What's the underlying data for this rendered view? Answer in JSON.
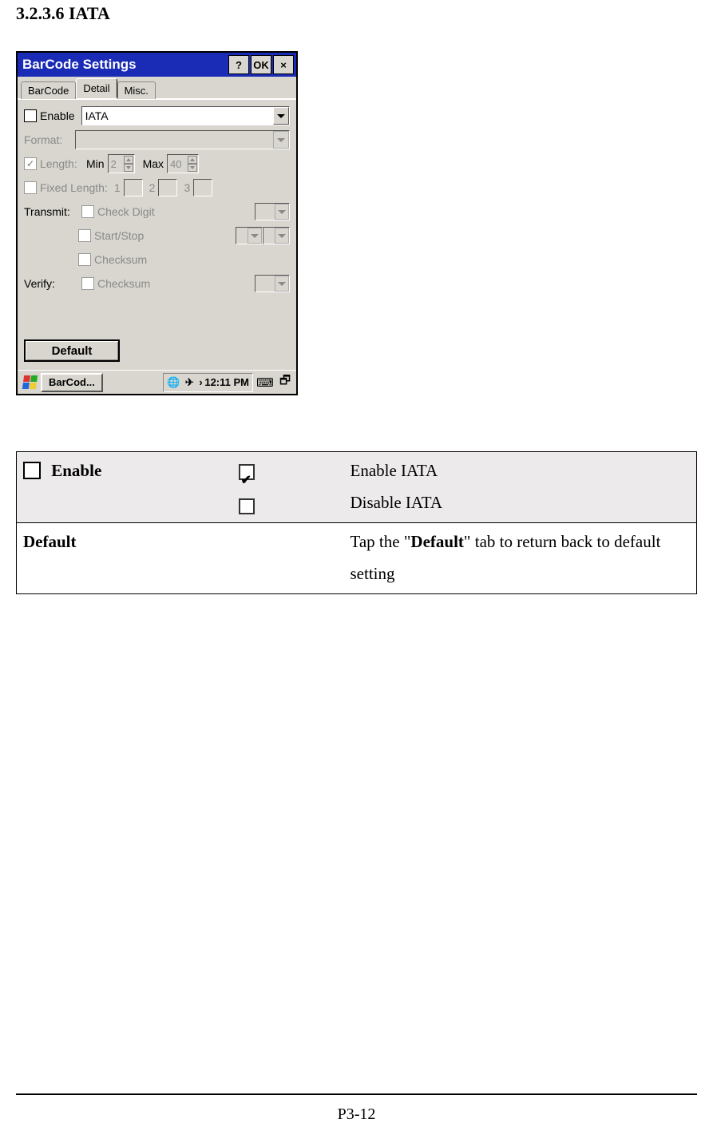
{
  "heading": "3.2.3.6 IATA",
  "dialog": {
    "title": "BarCode Settings",
    "buttons": {
      "help": "?",
      "ok": "OK",
      "close": "×"
    },
    "tabs": [
      "BarCode",
      "Detail",
      "Misc."
    ],
    "active_tab": "Detail",
    "fields": {
      "enable_label": "Enable",
      "symbology": "IATA",
      "format_label": "Format:",
      "length_label": "Length:",
      "min_label": "Min",
      "min_value": "2",
      "max_label": "Max",
      "max_value": "40",
      "fixed_label": "Fixed Length:",
      "fixed1": "1",
      "fixed2": "2",
      "fixed3": "3",
      "transmit_label": "Transmit:",
      "checkdigit_label": "Check Digit",
      "startstop_label": "Start/Stop",
      "checksum_label": "Checksum",
      "verify_label": "Verify:",
      "verify_checksum_label": "Checksum"
    },
    "default_btn": "Default",
    "taskbar": {
      "app": "BarCod...",
      "time": "12:11 PM"
    }
  },
  "table": {
    "row1_label": "Enable",
    "row1_on": "Enable IATA",
    "row1_off": "Disable IATA",
    "row2_label": "Default",
    "row2_desc_pre": "Tap the \"",
    "row2_desc_bold": "Default",
    "row2_desc_post": "\" tab to return back to default setting"
  },
  "page_number": "P3-12"
}
